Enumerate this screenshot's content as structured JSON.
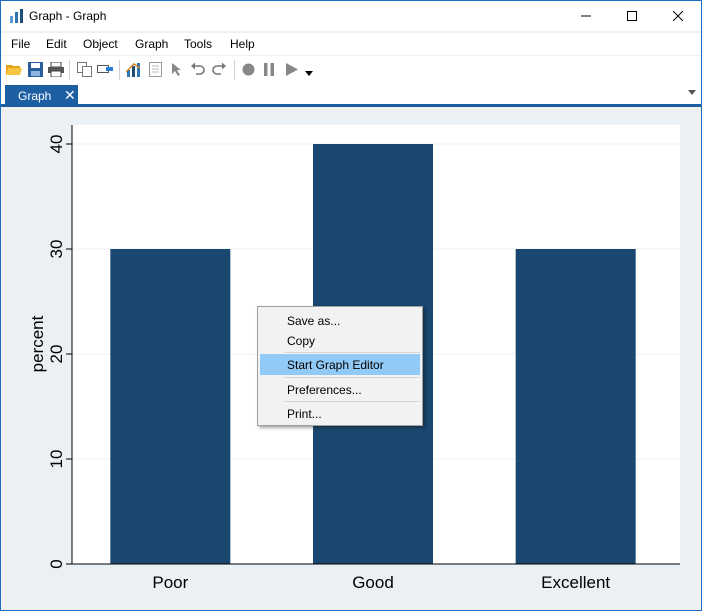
{
  "window": {
    "title": "Graph - Graph",
    "icon": "bar-chart-icon"
  },
  "menubar": {
    "items": [
      "File",
      "Edit",
      "Object",
      "Graph",
      "Tools",
      "Help"
    ]
  },
  "toolbar": {
    "icons": [
      "open-folder-icon",
      "save-icon",
      "print-icon",
      "copy-icon",
      "rename-icon",
      "graph-editor-icon",
      "data-browser-icon",
      "pointer-icon",
      "undo-icon",
      "redo-icon",
      "record-icon",
      "pause-icon",
      "play-icon",
      "dropdown-arrow-icon"
    ]
  },
  "tabs": [
    {
      "label": "Graph",
      "close": "✕"
    }
  ],
  "context_menu": {
    "items": [
      "Save as...",
      "Copy",
      "Start Graph Editor",
      "Preferences...",
      "Print..."
    ],
    "highlighted": "Start Graph Editor"
  },
  "colors": {
    "bar": "#1a476f",
    "plot_region": "#ffffff",
    "graph_region": "#eaf0f3",
    "tab_active": "#1c5fa3",
    "menu_highlight": "#91c9f7"
  },
  "chart_data": {
    "type": "bar",
    "categories": [
      "Poor",
      "Good",
      "Excellent"
    ],
    "values": [
      30,
      40,
      30
    ],
    "ylabel": "percent",
    "xlabel": "",
    "ylim": [
      0,
      40
    ],
    "yticks": [
      0,
      10,
      20,
      30,
      40
    ],
    "grid": true
  }
}
